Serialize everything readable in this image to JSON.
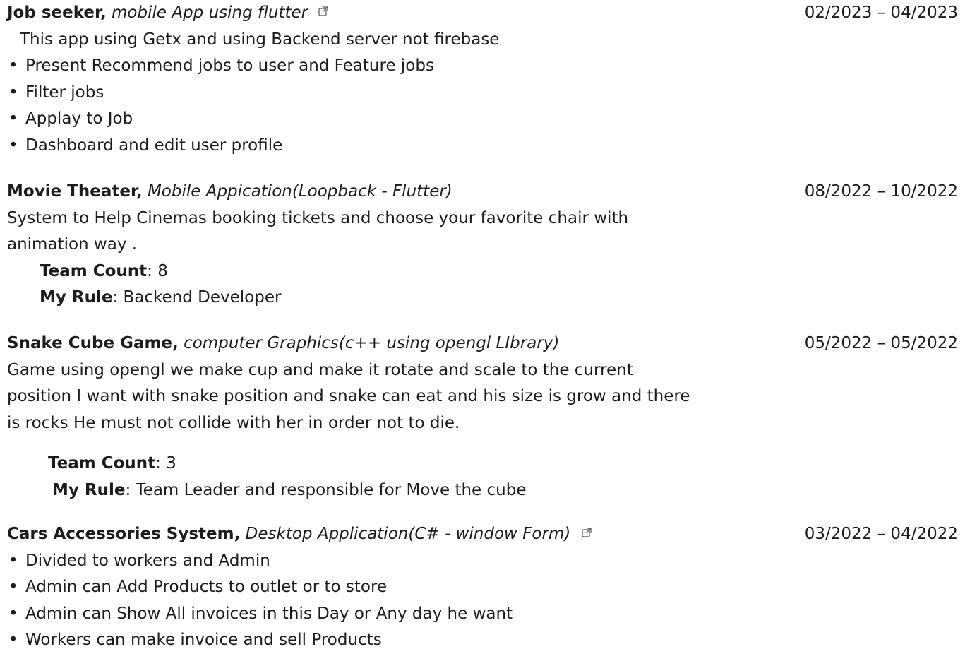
{
  "projects": [
    {
      "title": "Job seeker,",
      "subtitle": "mobile App using flutter",
      "dates": "02/2023 – 04/2023",
      "intro": "This app using Getx and using Backend server not firebase",
      "bullets": [
        "Present Recommend jobs to user and Feature jobs",
        "Filter jobs",
        "Applay to Job",
        "Dashboard and edit user profile"
      ]
    },
    {
      "title": "Movie Theater,",
      "subtitle": "Mobile Appication(Loopback - Flutter)",
      "dates": "08/2022 – 10/2022",
      "description": [
        "System to Help Cinemas booking tickets and choose your favorite chair with",
        "animation way ."
      ],
      "team_count_label": "Team Count",
      "team_count_value": ": 8",
      "role_label": "My Rule",
      "role_value": ": Backend Developer"
    },
    {
      "title": "Snake Cube Game,",
      "subtitle": "computer Graphics(c++ using opengl LIbrary)",
      "dates": "05/2022 – 05/2022",
      "description": [
        "Game using opengl we make cup and make it rotate and scale to the current",
        "position I want with snake position and snake can eat and his size is grow and there",
        "is rocks He must not collide with her in order not to die."
      ],
      "team_count_label": "Team Count",
      "team_count_value": ": 3",
      "role_label": "My Rule",
      "role_value": ": Team Leader and responsible for Move the cube"
    },
    {
      "title": "Cars Accessories System,",
      "subtitle": "Desktop Application(C# - window Form)",
      "dates": "03/2022 – 04/2022",
      "bullets": [
        "Divided to workers and Admin",
        "Admin can Add Products to outlet or to store",
        "Admin can Show All invoices in this Day or Any day he want",
        "Workers can make invoice and sell Products"
      ]
    }
  ],
  "icons": {
    "external_link": "external-link-icon"
  }
}
